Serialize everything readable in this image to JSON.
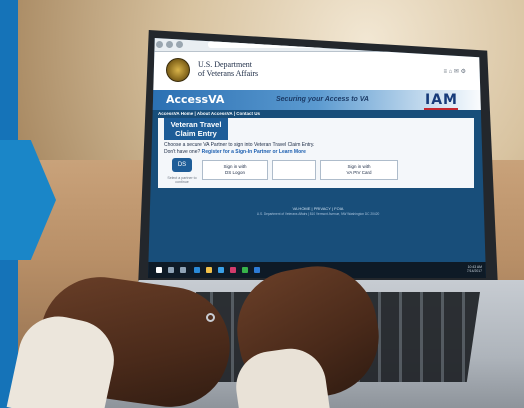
{
  "colors": {
    "brand_blue": "#1573b8",
    "va_navy": "#1e5d98",
    "iam_blue": "#173b7a",
    "iam_red": "#c4262e",
    "screen_bg": "#184e7a"
  },
  "va": {
    "dept_line1": "U.S. Department",
    "dept_line2": "of Veterans Affairs",
    "header_icons": "≡  ⌂  ✉  ⚙"
  },
  "access": {
    "logo": "AccessVA",
    "tagline": "Securing your Access to VA",
    "iam": "IAM"
  },
  "nav": {
    "links": "AccessVA Home | About AccessVA | Contact Us"
  },
  "app": {
    "title_line1": "Veteran Travel",
    "title_line2": "Claim Entry",
    "partner_text": "Choose a secure VA Partner to sign into Veteran Travel Claim Entry.",
    "register_prefix": "Don't have one? ",
    "register_link": "Register for a Sign-In Partner or Learn More"
  },
  "tiles": {
    "ds_icon": "DS",
    "ds_line1": "Sign in with",
    "ds_line2": "DS Logon",
    "piv_line1": "Sign in with",
    "piv_line2": "VA PIV Card",
    "select_partner": "Select a partner to continue"
  },
  "footer": {
    "links": "VA HOME  |  PRIVACY  |  FOIA",
    "address": "U.S. Department of Veterans Affairs | 810 Vermont Avenue, NW Washington DC 20420"
  },
  "taskbar": {
    "time": "10:43 AM",
    "date": "7/14/2017"
  }
}
